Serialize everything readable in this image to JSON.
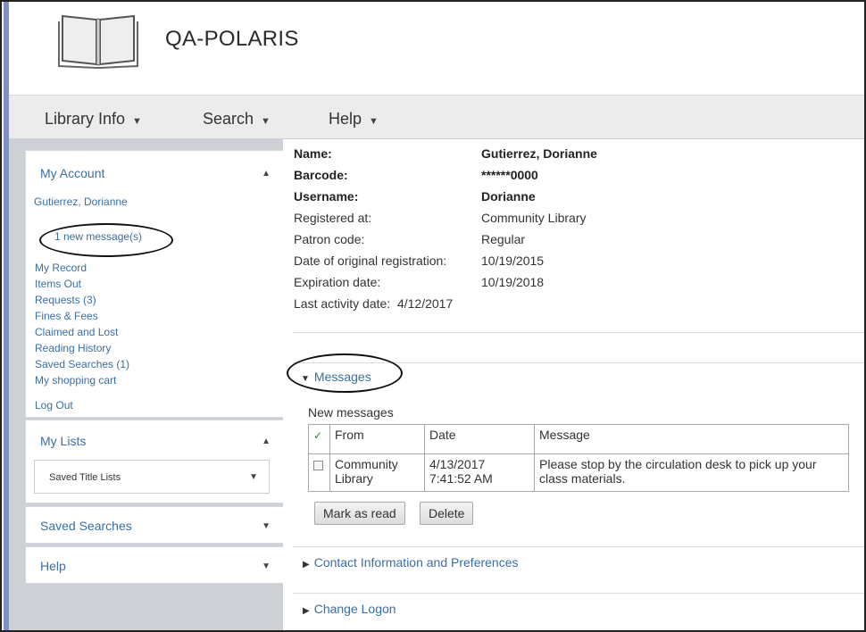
{
  "site": {
    "title": "QA-POLARIS",
    "logo_icon": "open-book-icon"
  },
  "nav": [
    {
      "label": "Library Info"
    },
    {
      "label": "Search"
    },
    {
      "label": "Help"
    }
  ],
  "sidebar": {
    "my_account": {
      "title": "My Account",
      "patron_name": "Gutierrez, Dorianne",
      "new_messages": "1 new message(s)",
      "links": [
        "My Record",
        "Items Out",
        "Requests (3)",
        "Fines & Fees",
        "Claimed and Lost",
        "Reading History",
        "Saved Searches (1)",
        "My shopping cart"
      ],
      "logout": "Log Out"
    },
    "my_lists": {
      "title": "My Lists",
      "selected": "Saved Title Lists"
    },
    "saved_searches": {
      "title": "Saved Searches"
    },
    "help": {
      "title": "Help"
    }
  },
  "record": {
    "rows": [
      {
        "label": "Name:",
        "value": "Gutierrez, Dorianne",
        "bold": true
      },
      {
        "label": "Barcode:",
        "value": "******0000",
        "bold": true
      },
      {
        "label": "Username:",
        "value": "Dorianne",
        "bold": true
      },
      {
        "label": "Registered at:",
        "value": "Community Library",
        "bold": false
      },
      {
        "label": "Patron code:",
        "value": "Regular",
        "bold": false
      },
      {
        "label": "Date of original registration:",
        "value": "10/19/2015",
        "bold": false
      },
      {
        "label": "Expiration date:",
        "value": "10/19/2018",
        "bold": false
      }
    ],
    "last_activity": "Last activity date:  4/12/2017"
  },
  "messages": {
    "section_title": "Messages",
    "subtitle": "New messages",
    "columns": {
      "from": "From",
      "date": "Date",
      "message": "Message"
    },
    "rows": [
      {
        "from_line1": "Community",
        "from_line2": "Library",
        "date_line1": "4/13/2017",
        "date_line2": "7:41:52 AM",
        "message": "Please stop by the circulation desk to pick up your class materials."
      }
    ],
    "mark_read": "Mark as read",
    "delete": "Delete"
  },
  "sections": {
    "contact": "Contact Information and Preferences",
    "logon": "Change Logon"
  },
  "colors": {
    "link": "#3a6ea5",
    "sidebar_bg": "#cdd1d6",
    "nav_bg": "#ececec"
  }
}
